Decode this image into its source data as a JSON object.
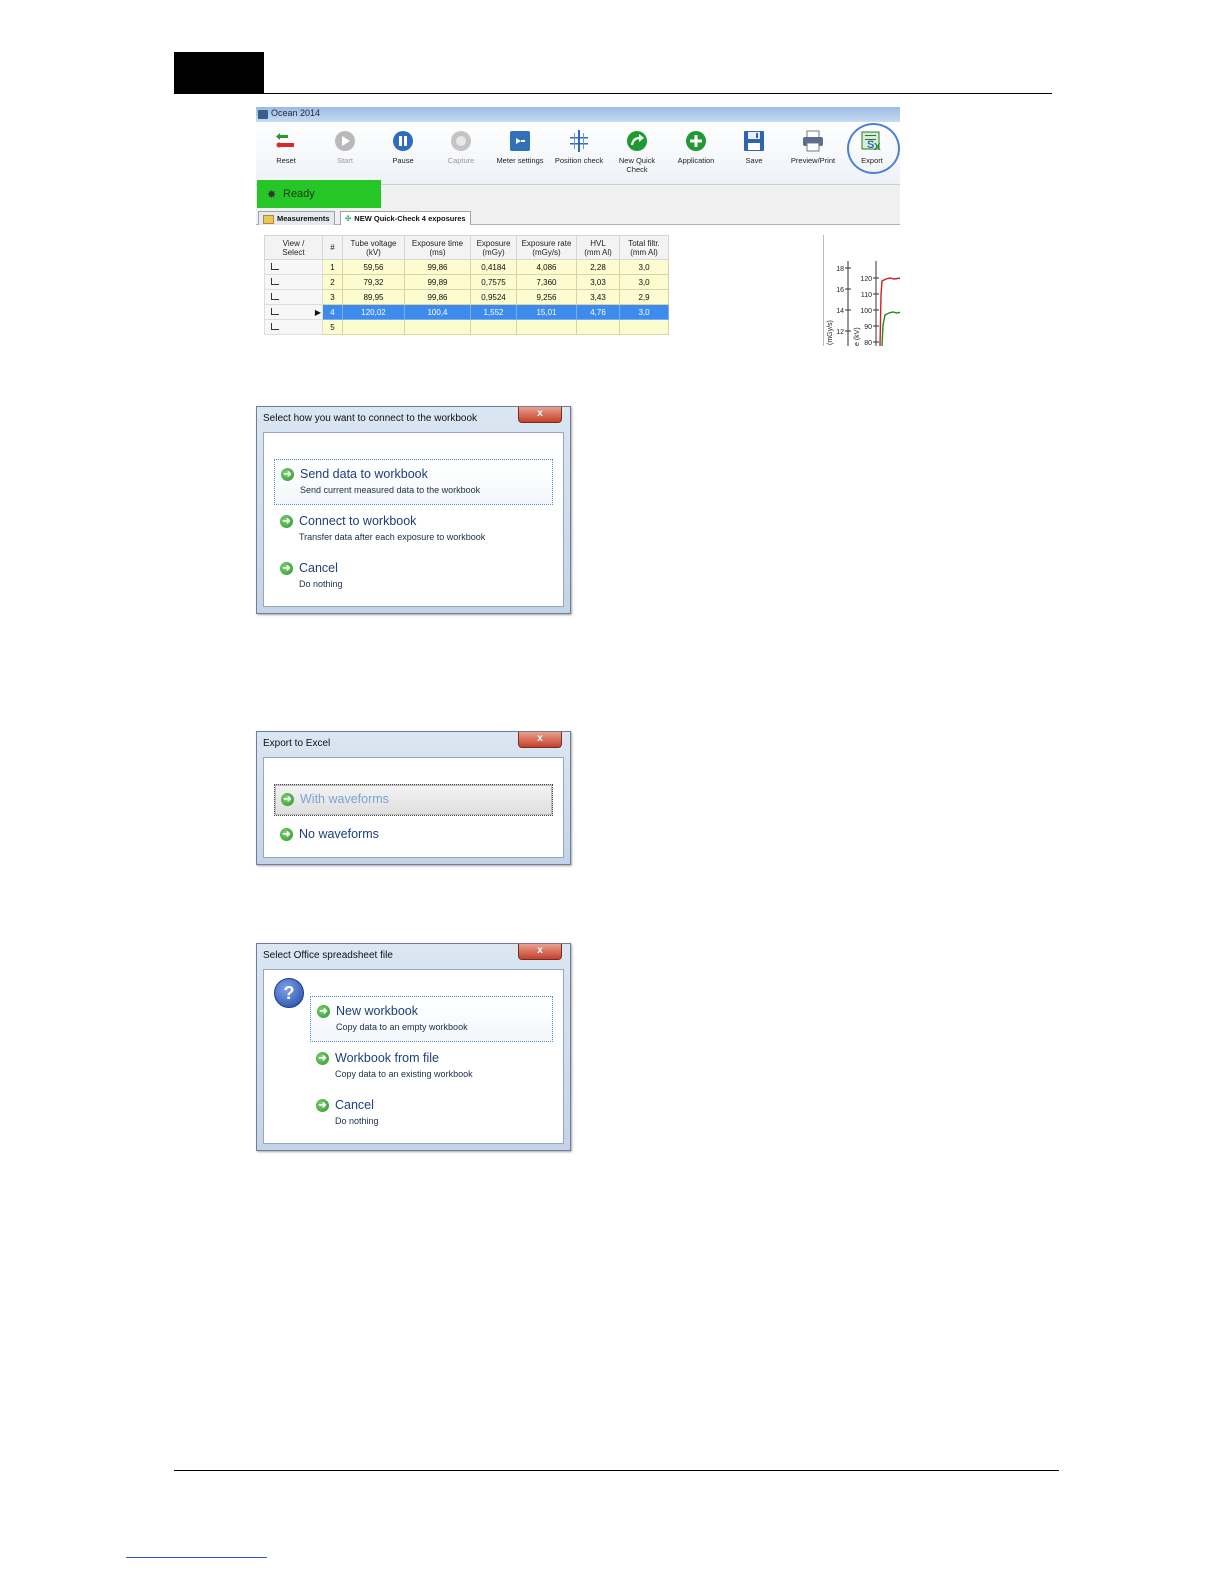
{
  "app": {
    "window_title": "Ocean 2014",
    "toolbar": [
      {
        "label": "Reset",
        "icon": "reset-icon",
        "enabled": true
      },
      {
        "label": "Start",
        "icon": "play-icon",
        "enabled": false
      },
      {
        "label": "Pause",
        "icon": "pause-icon",
        "enabled": true
      },
      {
        "label": "Capture",
        "icon": "capture-icon",
        "enabled": false
      },
      {
        "label": "Meter settings",
        "icon": "meter-settings-icon",
        "enabled": true
      },
      {
        "label": "Position check",
        "icon": "position-check-icon",
        "enabled": true
      },
      {
        "label": "New Quick Check",
        "icon": "new-quick-check-icon",
        "enabled": true
      },
      {
        "label": "Application",
        "icon": "application-icon",
        "enabled": true
      },
      {
        "label": "Save",
        "icon": "save-icon",
        "enabled": true
      },
      {
        "label": "Preview/Print",
        "icon": "printer-icon",
        "enabled": true
      },
      {
        "label": "Export",
        "icon": "excel-export-icon",
        "enabled": true
      }
    ],
    "status": "Ready",
    "tabs": [
      "Measurements",
      "NEW Quick-Check 4 exposures"
    ],
    "grid": {
      "headers": [
        [
          "View /",
          "Select"
        ],
        [
          "#",
          ""
        ],
        [
          "Tube voltage",
          "(kV)"
        ],
        [
          "Exposure time",
          "(ms)"
        ],
        [
          "Exposure",
          "(mGy)"
        ],
        [
          "Exposure rate",
          "(mGy/s)"
        ],
        [
          "HVL",
          "(mm Al)"
        ],
        [
          "Total filtr.",
          "(mm Al)"
        ]
      ],
      "rows": [
        {
          "n": "1",
          "kv": "59,56",
          "ms": "99,86",
          "mgy": "0,4184",
          "rate": "4,086",
          "hvl": "2,28",
          "filt": "3,0"
        },
        {
          "n": "2",
          "kv": "79,32",
          "ms": "99,89",
          "mgy": "0,7575",
          "rate": "7,360",
          "hvl": "3,03",
          "filt": "3,0"
        },
        {
          "n": "3",
          "kv": "89,95",
          "ms": "99,86",
          "mgy": "0,9524",
          "rate": "9,256",
          "hvl": "3,43",
          "filt": "2,9"
        },
        {
          "n": "4",
          "kv": "120,02",
          "ms": "100,4",
          "mgy": "1,552",
          "rate": "15,01",
          "hvl": "4,76",
          "filt": "3,0"
        },
        {
          "n": "5",
          "kv": "",
          "ms": "",
          "mgy": "",
          "rate": "",
          "hvl": "",
          "filt": ""
        }
      ],
      "selected_row": 4
    },
    "graph": {
      "left_ticks": [
        "18",
        "16",
        "14",
        "12"
      ],
      "right_ticks": [
        "120",
        "110",
        "100",
        "90",
        "80"
      ],
      "left_axis_label": "(mGy/s)",
      "right_axis_label": "e (kV)",
      "series_colors": [
        "#cc2222",
        "#1d8a1d"
      ]
    }
  },
  "dialogs": {
    "connect": {
      "title": "Select how you want to connect to the workbook",
      "options": [
        {
          "main": "Send data to workbook",
          "sub": "Send current measured data to the workbook"
        },
        {
          "main": "Connect to workbook",
          "sub": "Transfer data after each exposure to workbook"
        },
        {
          "main": "Cancel",
          "sub": "Do nothing"
        }
      ]
    },
    "export": {
      "title": "Export to Excel",
      "options": [
        {
          "main": "With waveforms"
        },
        {
          "main": "No waveforms"
        }
      ]
    },
    "select_file": {
      "title": "Select Office spreadsheet file",
      "question_glyph": "?",
      "options": [
        {
          "main": "New workbook",
          "sub": "Copy data to an empty workbook"
        },
        {
          "main": "Workbook from file",
          "sub": "Copy data to an existing workbook"
        },
        {
          "main": "Cancel",
          "sub": "Do nothing"
        }
      ]
    },
    "close_glyph": "x",
    "arrow_glyph": "➜"
  }
}
